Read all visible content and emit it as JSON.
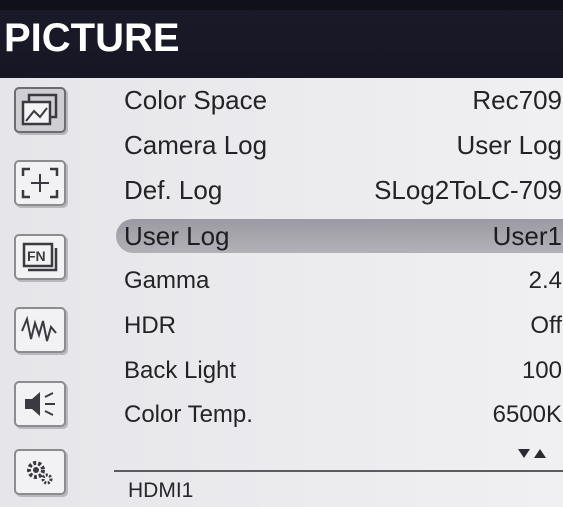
{
  "header": {
    "title": "PICTURE"
  },
  "sidebar": {
    "icons": [
      {
        "name": "picture-icon",
        "active": true
      },
      {
        "name": "marker-frame-icon",
        "active": false
      },
      {
        "name": "fn-icon",
        "active": false
      },
      {
        "name": "waveform-icon",
        "active": false
      },
      {
        "name": "audio-icon",
        "active": false
      },
      {
        "name": "settings-icon",
        "active": false
      }
    ]
  },
  "menu": {
    "items": [
      {
        "label": "Color Space",
        "value": "Rec709"
      },
      {
        "label": "Camera Log",
        "value": "User Log"
      },
      {
        "label": "Def. Log",
        "value": "SLog2ToLC-709"
      },
      {
        "label": "User Log",
        "value": "User1",
        "selected": true
      },
      {
        "label": "Gamma",
        "value": "2.4"
      },
      {
        "label": "HDR",
        "value": "Off"
      },
      {
        "label": "Back Light",
        "value": "100"
      },
      {
        "label": "Color Temp.",
        "value": "6500K"
      }
    ]
  },
  "footer": {
    "source": "HDMI1"
  },
  "colors": {
    "header_bg": "#161624",
    "header_text": "#ffffff",
    "body_bg": "#e9e9ec",
    "selection_bg": "#a8a6ad",
    "text": "#242428"
  }
}
